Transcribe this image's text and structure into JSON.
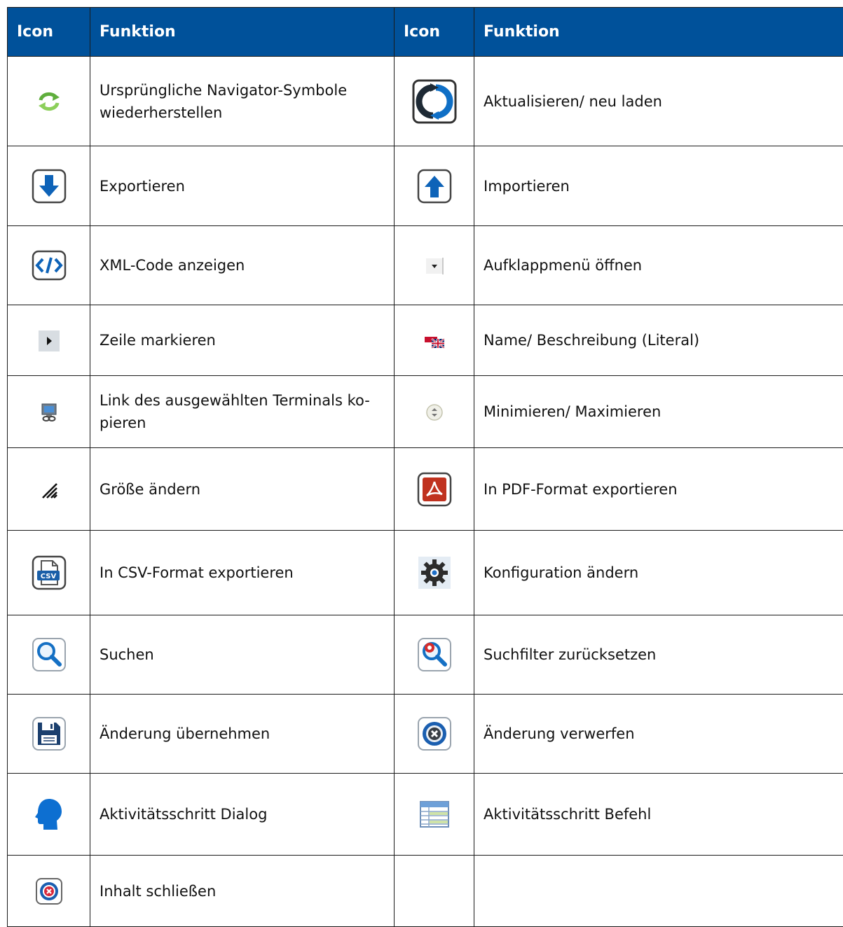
{
  "table": {
    "headers": [
      "Icon",
      "Funktion",
      "Icon",
      "Funktion"
    ],
    "rows": [
      {
        "left": {
          "icon": "refresh-green-arrows-icon",
          "text": "Ursprüngliche Navigator-Symbole wiederherstellen"
        },
        "right": {
          "icon": "reload-icon",
          "text": "Aktualisieren/ neu laden"
        }
      },
      {
        "left": {
          "icon": "export-arrow-down-icon",
          "text": "Exportieren"
        },
        "right": {
          "icon": "import-arrow-up-icon",
          "text": "Importieren"
        }
      },
      {
        "left": {
          "icon": "xml-code-icon",
          "text": "XML-Code anzeigen"
        },
        "right": {
          "icon": "dropdown-arrow-icon",
          "text": "Aufklappmenü öffnen"
        }
      },
      {
        "left": {
          "icon": "row-marker-icon",
          "text": "Zeile markieren"
        },
        "right": {
          "icon": "flags-icon",
          "text": "Name/ Beschreibung (Literal)"
        }
      },
      {
        "left": {
          "icon": "terminal-link-icon",
          "text": "Link des ausgewählten Terminals ko-pieren"
        },
        "right": {
          "icon": "minimize-maximize-icon",
          "text": "Minimieren/ Maximieren"
        }
      },
      {
        "left": {
          "icon": "resize-grip-icon",
          "text": "Größe ändern"
        },
        "right": {
          "icon": "pdf-export-icon",
          "text": "In PDF-Format exportieren"
        }
      },
      {
        "left": {
          "icon": "csv-export-icon",
          "text": "In CSV-Format exportieren"
        },
        "right": {
          "icon": "gear-icon",
          "text": "Konfiguration ändern"
        }
      },
      {
        "left": {
          "icon": "search-icon",
          "text": "Suchen"
        },
        "right": {
          "icon": "reset-search-filter-icon",
          "text": "Suchfilter zurücksetzen"
        }
      },
      {
        "left": {
          "icon": "save-icon",
          "text": "Änderung übernehmen"
        },
        "right": {
          "icon": "discard-icon",
          "text": "Änderung verwerfen"
        }
      },
      {
        "left": {
          "icon": "person-dialog-icon",
          "text": "Aktivitätsschritt Dialog"
        },
        "right": {
          "icon": "command-table-icon",
          "text": "Aktivitätsschritt Befehl"
        }
      },
      {
        "left": {
          "icon": "close-content-icon",
          "text": "Inhalt schließen"
        },
        "right": {
          "icon": "",
          "text": ""
        }
      }
    ]
  },
  "colors": {
    "header_bg": "#00519a",
    "header_text": "#ffffff",
    "border": "#1a1a1a"
  }
}
